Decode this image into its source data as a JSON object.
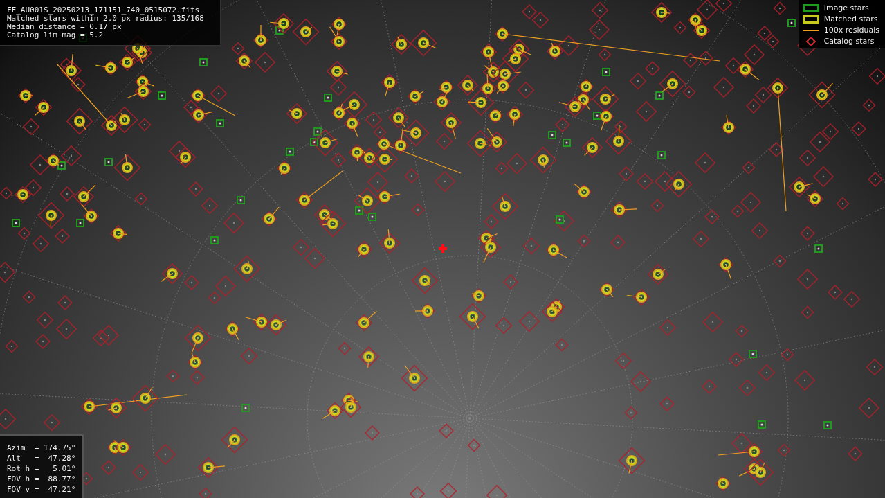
{
  "info_box": {
    "lines": [
      "FF_AU001S_20250213_171151_740_0515072.fits",
      "Matched stars within 2.0 px radius: 135/168",
      "Median distance = 0.17 px",
      "Catalog lim mag = 5.2"
    ]
  },
  "legend": [
    {
      "kind": "square",
      "color": "#1f9a1f",
      "label": "Image stars"
    },
    {
      "kind": "square",
      "color": "#c8c81e",
      "label": "Matched stars"
    },
    {
      "kind": "line",
      "color": "#f0a020",
      "label": "100x residuals"
    },
    {
      "kind": "diamond",
      "color": "#c0202a",
      "label": "Catalog stars"
    }
  ],
  "pointing_box": {
    "lines": [
      "Azim  = 174.75°",
      "Alt   =  47.28°",
      "Rot h =   5.01°",
      "FOV h =  88.77°",
      "FOV v =  47.21°"
    ]
  }
}
